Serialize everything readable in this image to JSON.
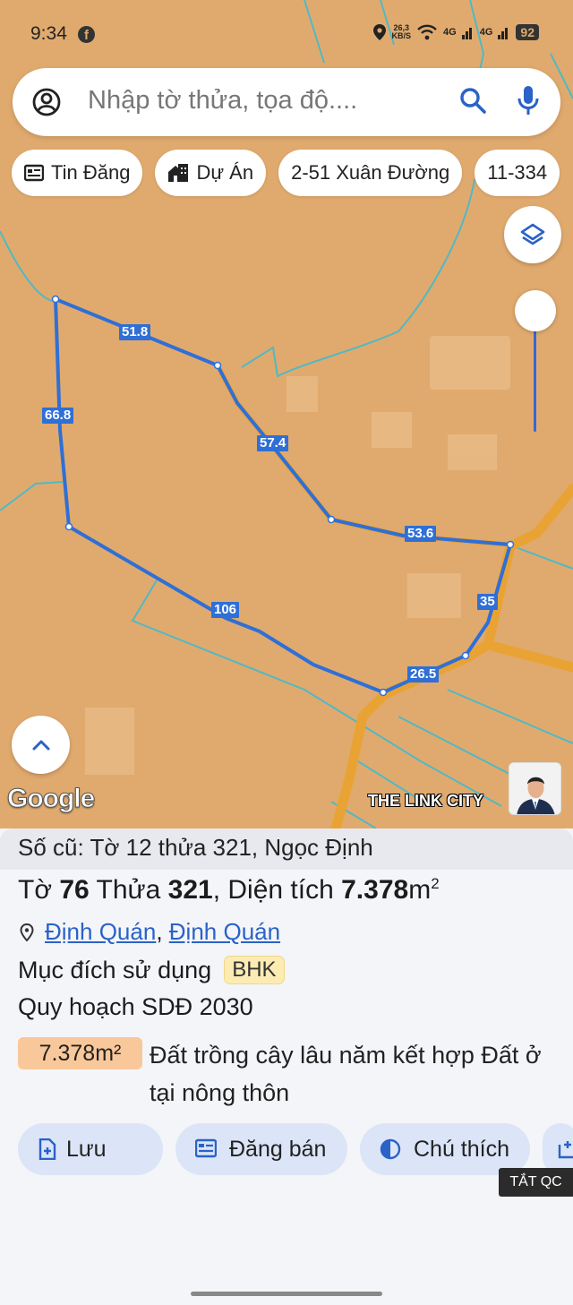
{
  "status_bar": {
    "time": "9:34",
    "net_speed_top": "26,3",
    "net_speed_bottom": "KB/S",
    "signal1": "4G",
    "signal2": "4G",
    "battery": "92"
  },
  "search": {
    "placeholder": "Nhập tờ thửa, tọa độ...."
  },
  "chips": [
    {
      "label": "Tin Đăng",
      "icon": "newspaper-icon"
    },
    {
      "label": "Dự Án",
      "icon": "building-icon"
    },
    {
      "label": "2-51 Xuân Đường",
      "icon": ""
    },
    {
      "label": "11-334",
      "icon": ""
    }
  ],
  "map": {
    "edge_lengths": [
      "51.8",
      "66.8",
      "57.4",
      "53.6",
      "35",
      "106",
      "26.5"
    ],
    "google_logo": "Google",
    "brand": "THE LINK CITY"
  },
  "parcel": {
    "old_info": "Số cũ: Tờ 12 thửa 321, Ngọc Định",
    "sheet_prefix": "Tờ",
    "sheet_no": "76",
    "plot_prefix": "Thửa",
    "plot_no": "321",
    "area_prefix": ", Diện tích",
    "area": "7.378",
    "area_unit": "m",
    "area_exp": "2",
    "location_1": "Định Quán",
    "location_sep": ",",
    "location_2": "Định Quán",
    "purpose_label": "Mục đích sử dụng",
    "purpose_code": "BHK",
    "plan_label": "Quy hoạch SDĐ 2030",
    "plan_area": "7.378m²",
    "plan_desc": "Đất trồng cây lâu năm kết hợp Đất ở tại nông thôn"
  },
  "actions": [
    {
      "label": "Lưu",
      "icon": "save-plus-icon"
    },
    {
      "label": "Đăng bán",
      "icon": "listing-icon"
    },
    {
      "label": "Chú thích",
      "icon": "half-circle-icon"
    }
  ],
  "ad_toggle": "TẮT QC",
  "colors": {
    "map_bg": "#e0aa6e",
    "parcel_line": "#2f6fd6",
    "road": "#e9a334",
    "cadastral": "#52b8c4",
    "accent": "#2a62c7"
  }
}
